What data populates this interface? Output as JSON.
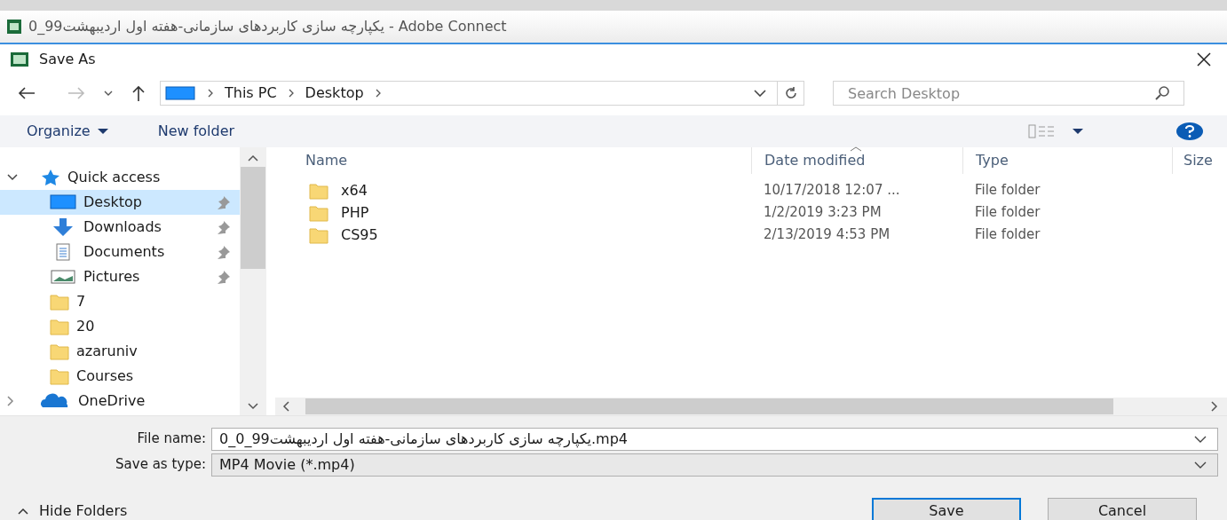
{
  "window": {
    "title": "یکپارچه سازی کاربردهای سازمانی-هفته اول اردیبهشت99_0 - Adobe Connect"
  },
  "dialog": {
    "title": "Save As"
  },
  "breadcrumb": [
    "This PC",
    "Desktop"
  ],
  "search": {
    "placeholder": "Search Desktop"
  },
  "toolbar": [
    "Organize",
    "New folder"
  ],
  "sidebar": {
    "items": [
      {
        "label": "Quick access",
        "kind": "quick",
        "selected": false,
        "expanded": true,
        "children": [
          {
            "label": "Desktop",
            "kind": "desktop",
            "selected": true,
            "pinned": true
          },
          {
            "label": "Downloads",
            "kind": "downloads",
            "selected": false,
            "pinned": true
          },
          {
            "label": "Documents",
            "kind": "documents",
            "selected": false,
            "pinned": true
          },
          {
            "label": "Pictures",
            "kind": "pictures",
            "selected": false,
            "pinned": true
          },
          {
            "label": "7",
            "kind": "folder",
            "selected": false,
            "pinned": false
          },
          {
            "label": "20",
            "kind": "folder",
            "selected": false,
            "pinned": false
          },
          {
            "label": "azaruniv",
            "kind": "folder",
            "selected": false,
            "pinned": false
          },
          {
            "label": "Courses",
            "kind": "folder",
            "selected": false,
            "pinned": false
          }
        ]
      },
      {
        "label": "OneDrive",
        "kind": "cloud",
        "selected": false,
        "expanded": false
      }
    ]
  },
  "table": {
    "columns": [
      "Name",
      "Date modified",
      "Type",
      "Size"
    ],
    "rows": [
      {
        "name": "x64",
        "date": "10/17/2018 12:07 ...",
        "type": "File folder"
      },
      {
        "name": "PHP",
        "date": "1/2/2019 3:23 PM",
        "type": "File folder"
      },
      {
        "name": "CS95",
        "date": "2/13/2019 4:53 PM",
        "type": "File folder"
      }
    ]
  },
  "file_name": {
    "label": "File name:",
    "value": "یکپارچه سازی کاربردهای سازمانی-هفته اول اردیبهشت99_0_0.mp4"
  },
  "save_type": {
    "label": "Save as type:",
    "value": "MP4 Movie (*.mp4)"
  },
  "hide_folders": "Hide Folders",
  "buttons": [
    "Save",
    "Cancel"
  ]
}
